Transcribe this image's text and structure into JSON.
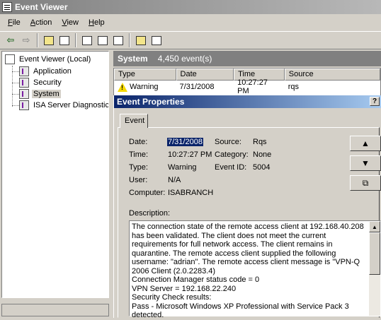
{
  "window": {
    "title": "Event Viewer"
  },
  "menu": [
    {
      "key": "F",
      "rest": "ile"
    },
    {
      "key": "A",
      "rest": "ction"
    },
    {
      "key": "V",
      "rest": "iew"
    },
    {
      "key": "H",
      "rest": "elp"
    }
  ],
  "tree": {
    "root": "Event Viewer (Local)",
    "items": [
      "Application",
      "Security",
      "System",
      "ISA Server Diagnostics"
    ],
    "selected": "System"
  },
  "panel": {
    "title": "System",
    "count": "4,450 event(s)"
  },
  "list": {
    "columns": [
      "Type",
      "Date",
      "Time",
      "Source"
    ],
    "rows": [
      {
        "type": "Warning",
        "date": "7/31/2008",
        "time": "10:27:27 PM",
        "source": "rqs"
      }
    ]
  },
  "dialog": {
    "title": "Event Properties",
    "help": "?",
    "tab": "Event",
    "labels": {
      "date": "Date:",
      "time": "Time:",
      "type": "Type:",
      "user": "User:",
      "computer": "Computer:",
      "source": "Source:",
      "category": "Category:",
      "event_id": "Event ID:",
      "description": "Description:"
    },
    "values": {
      "date": "7/31/2008",
      "time": "10:27:27 PM",
      "type": "Warning",
      "user": "N/A",
      "computer": "ISABRANCH",
      "source": "Rqs",
      "category": "None",
      "event_id": "5004"
    },
    "description": "The connection state of the remote access client at 192.168.40.208 has been validated. The client does not meet the current requirements for full network access. The client remains in quarantine. The remote access client supplied the following username: \"adrian\". The remote access client message is \"VPN-Q 2006 Client (2.0.2283.4)\nConnection Manager status code = 0\nVPN Server = 192.168.22.240\nSecurity Check results:\nPass - Microsoft Windows XP Professional with Service Pack 3 detected."
  }
}
